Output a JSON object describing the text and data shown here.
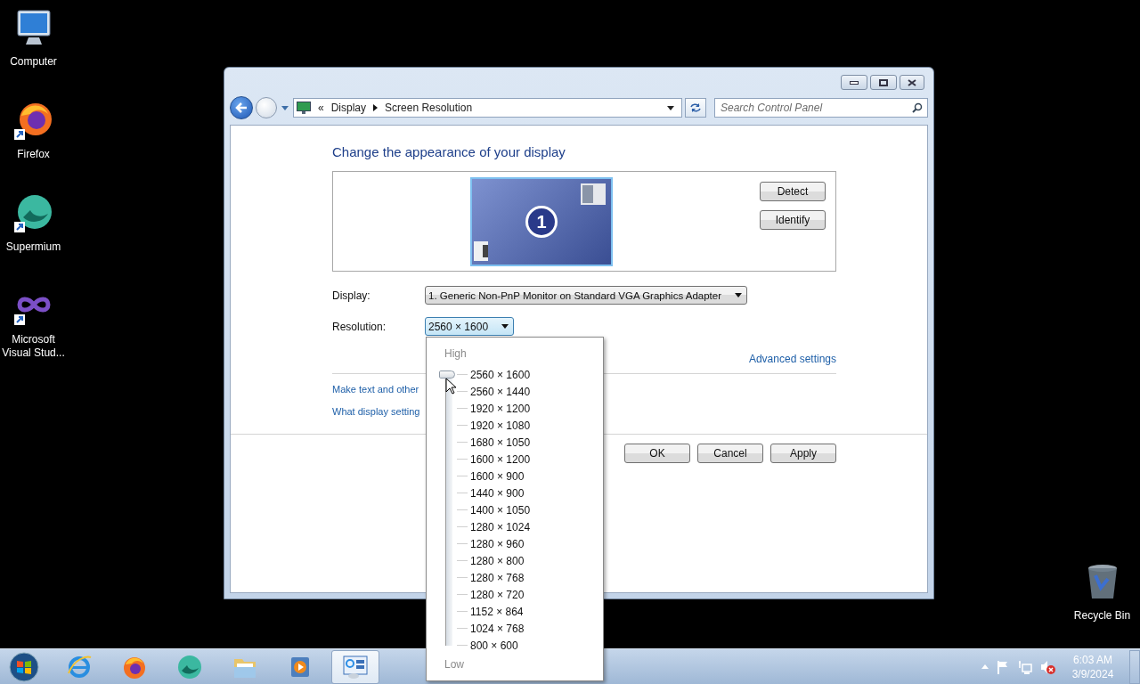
{
  "desktop_icons": [
    {
      "label": "Computer",
      "kind": "computer"
    },
    {
      "label": "Firefox",
      "kind": "firefox"
    },
    {
      "label": "Supermium",
      "kind": "supermium"
    },
    {
      "label": "Microsoft Visual Stud...",
      "kind": "visual_studio"
    }
  ],
  "recycle_bin": {
    "label": "Recycle Bin"
  },
  "window": {
    "address": {
      "overflow": "«",
      "crumbs": [
        "Display",
        "Screen Resolution"
      ]
    },
    "search": {
      "placeholder": "Search Control Panel"
    }
  },
  "heading": "Change the appearance of your display",
  "monitor": {
    "number": "1"
  },
  "monitor_buttons": [
    "Detect",
    "Identify"
  ],
  "display": {
    "label": "Display:",
    "value": "1. Generic Non-PnP Monitor on Standard VGA Graphics Adapter"
  },
  "resolution": {
    "label": "Resolution:",
    "value": "2560 × 1600",
    "expanded": true
  },
  "advanced_link": "Advanced settings",
  "links": [
    "Make text and other",
    "What display setting"
  ],
  "dialog_buttons": [
    "OK",
    "Cancel",
    "Apply"
  ],
  "resolution_popup": {
    "high": "High",
    "low": "Low",
    "level": 1,
    "options": [
      "2560 × 1600",
      "2560 × 1440",
      "1920 × 1200",
      "1920 × 1080",
      "1680 × 1050",
      "1600 × 1200",
      "1600 × 900",
      "1440 × 900",
      "1400 × 1050",
      "1280 × 1024",
      "1280 × 960",
      "1280 × 800",
      "1280 × 768",
      "1280 × 720",
      "1152 × 864",
      "1024 × 768",
      "800 × 600"
    ]
  },
  "taskbar": {
    "items": [
      {
        "kind": "ie",
        "active": false
      },
      {
        "kind": "firefox",
        "active": false
      },
      {
        "kind": "supermium",
        "active": false
      },
      {
        "kind": "explorer",
        "active": false
      },
      {
        "kind": "media",
        "active": false
      },
      {
        "kind": "control_panel",
        "active": true
      }
    ],
    "clock": {
      "time": "6:03 AM",
      "date": "3/9/2024"
    }
  }
}
